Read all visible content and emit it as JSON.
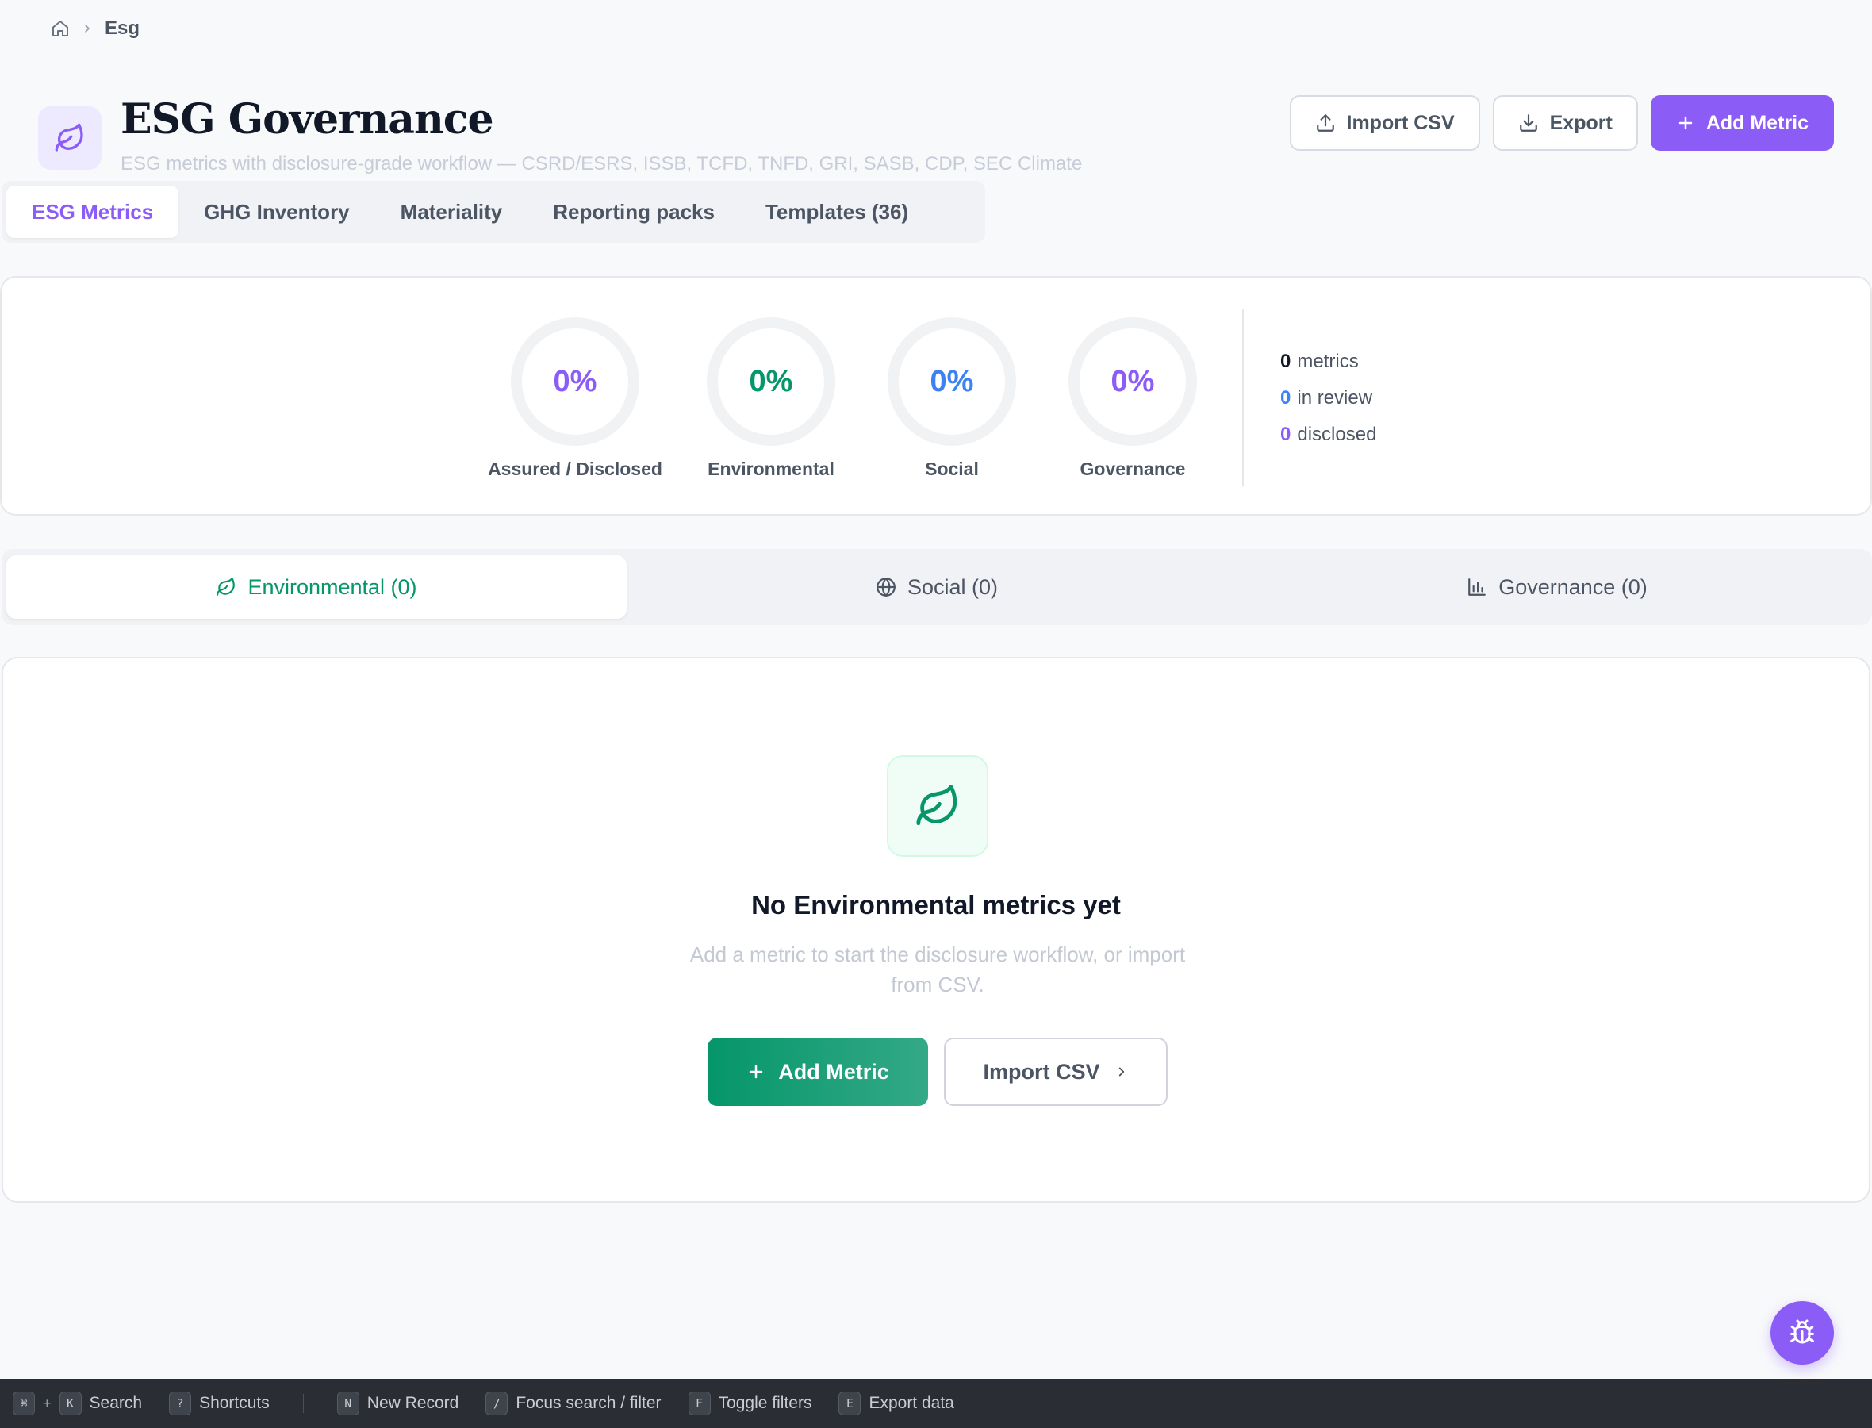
{
  "breadcrumb": {
    "current": "Esg"
  },
  "header": {
    "title": "ESG Governance",
    "subtitle": "ESG metrics with disclosure-grade workflow — CSRD/ESRS, ISSB, TCFD, TNFD, GRI, SASB, CDP, SEC Climate",
    "import_label": "Import CSV",
    "export_label": "Export",
    "add_label": "Add Metric"
  },
  "tabs": [
    {
      "label": "ESG Metrics",
      "active": true
    },
    {
      "label": "GHG Inventory"
    },
    {
      "label": "Materiality"
    },
    {
      "label": "Reporting packs"
    },
    {
      "label": "Templates (36)"
    }
  ],
  "rings": [
    {
      "value": "0%",
      "label": "Assured / Disclosed",
      "color": "#8b5cf6"
    },
    {
      "value": "0%",
      "label": "Environmental",
      "color": "#059669"
    },
    {
      "value": "0%",
      "label": "Social",
      "color": "#3b82f6"
    },
    {
      "value": "0%",
      "label": "Governance",
      "color": "#8b5cf6"
    }
  ],
  "summary": [
    {
      "count": "0",
      "text": "metrics",
      "color": "#111827"
    },
    {
      "count": "0",
      "text": "in review",
      "color": "#3b82f6"
    },
    {
      "count": "0",
      "text": "disclosed",
      "color": "#8b5cf6"
    }
  ],
  "category_tabs": [
    {
      "label": "Environmental (0)",
      "icon": "leaf-icon",
      "active": true
    },
    {
      "label": "Social (0)",
      "icon": "globe-icon"
    },
    {
      "label": "Governance (0)",
      "icon": "bar-chart-icon"
    }
  ],
  "empty_state": {
    "title": "No Environmental metrics yet",
    "description": "Add a metric to start the disclosure workflow, or import from CSV.",
    "add_label": "Add Metric",
    "import_label": "Import CSV"
  },
  "shortcuts": {
    "search": {
      "keys": [
        "⌘",
        "K"
      ],
      "label": "Search"
    },
    "help": {
      "key": "?",
      "label": "Shortcuts"
    },
    "items": [
      {
        "key": "N",
        "label": "New Record"
      },
      {
        "key": "/",
        "label": "Focus search / filter"
      },
      {
        "key": "F",
        "label": "Toggle filters"
      },
      {
        "key": "E",
        "label": "Export data"
      }
    ]
  },
  "colors": {
    "accent": "#8b5cf6",
    "green": "#059669",
    "blue": "#3b82f6"
  }
}
